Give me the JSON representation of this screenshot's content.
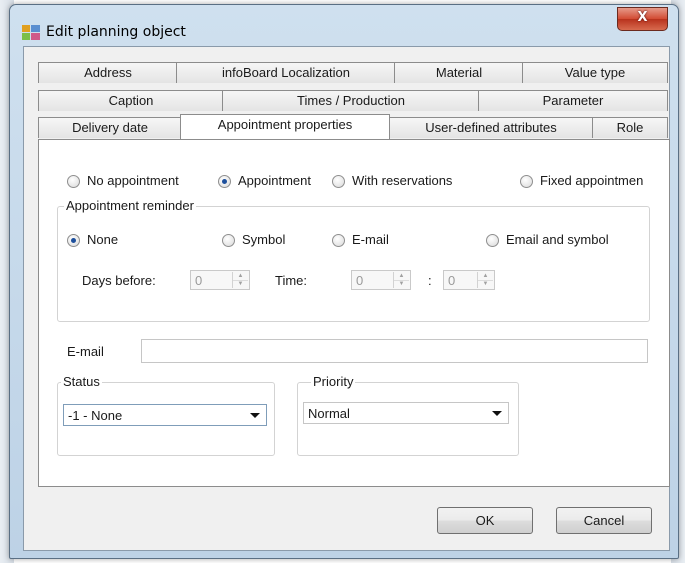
{
  "window": {
    "title": "Edit planning object",
    "close_glyph": "X",
    "icon": "app-icon"
  },
  "tabs": {
    "row1": [
      "Address",
      "infoBoard Localization",
      "Material",
      "Value type"
    ],
    "row2": [
      "Caption",
      "Times / Production",
      "Parameter"
    ],
    "row3": [
      "Delivery date",
      "Appointment properties",
      "User-defined attributes",
      "Role"
    ],
    "active": "Appointment properties"
  },
  "appointment_type": {
    "options": [
      "No appointment",
      "Appointment",
      "With reservations",
      "Fixed appointmen"
    ],
    "selected": "Appointment"
  },
  "reminder": {
    "group_title": "Appointment reminder",
    "options": [
      "None",
      "Symbol",
      "E-mail",
      "Email and symbol"
    ],
    "selected": "None",
    "days_before_label": "Days before:",
    "days_before_value": "0",
    "time_label": "Time:",
    "hour_value": "0",
    "time_separator": ":",
    "minute_value": "0"
  },
  "email": {
    "label": "E-mail",
    "value": ""
  },
  "status": {
    "group_title": "Status",
    "selected": "-1 - None"
  },
  "priority": {
    "group_title": "Priority",
    "selected": "Normal"
  },
  "buttons": {
    "ok": "OK",
    "cancel": "Cancel"
  },
  "colors": {
    "title_bar": "#bdd2e6",
    "close_button": "#d24a32",
    "radio_dot": "#1d4f9c"
  }
}
